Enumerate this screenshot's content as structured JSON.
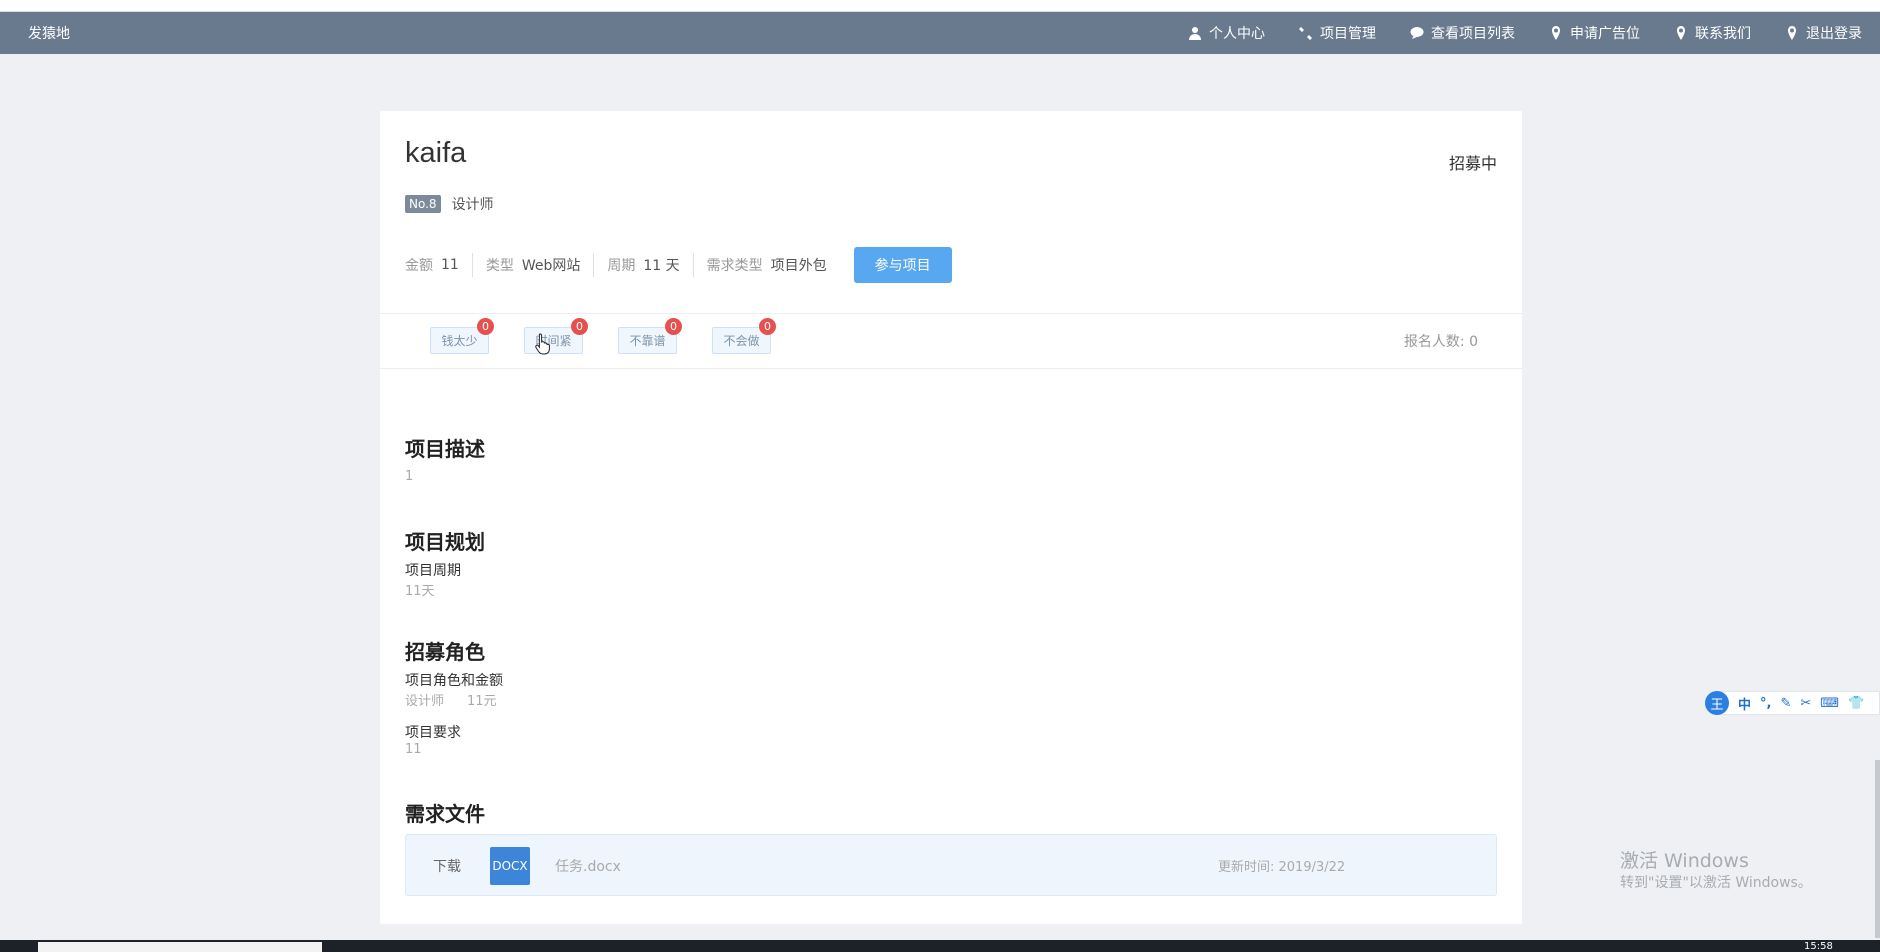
{
  "navbar": {
    "brand": "发猿地",
    "items": [
      {
        "label": "个人中心",
        "icon": "user-icon"
      },
      {
        "label": "项目管理",
        "icon": "wrench-icon"
      },
      {
        "label": "查看项目列表",
        "icon": "comment-icon"
      },
      {
        "label": "申请广告位",
        "icon": "map-marker-icon"
      },
      {
        "label": "联系我们",
        "icon": "map-marker-icon"
      },
      {
        "label": "退出登录",
        "icon": "map-marker-icon"
      }
    ]
  },
  "project": {
    "title": "kaifa",
    "status": "招募中",
    "badge": "No.8",
    "role": "设计师",
    "meta": [
      {
        "key": "金额",
        "value": "11"
      },
      {
        "key": "类型",
        "value": "Web网站"
      },
      {
        "key": "周期",
        "value": "11 天"
      },
      {
        "key": "需求类型",
        "value": "项目外包"
      }
    ],
    "join_label": "参与项目"
  },
  "feedback": {
    "tags": [
      {
        "label": "钱太少",
        "count": "0"
      },
      {
        "label": "时间紧",
        "count": "0"
      },
      {
        "label": "不靠谱",
        "count": "0"
      },
      {
        "label": "不会做",
        "count": "0"
      }
    ],
    "signup": "报名人数: 0"
  },
  "sections": {
    "description": {
      "title": "项目描述",
      "value": "1"
    },
    "plan": {
      "title": "项目规划",
      "label": "项目周期",
      "value": "11天"
    },
    "recruit": {
      "title": "招募角色",
      "role_label": "项目角色和金额",
      "role_value": "设计师",
      "amount_value": "11元",
      "req_label": "项目要求",
      "req_value": "11"
    },
    "files": {
      "title": "需求文件",
      "download": "下载",
      "icon_text": "DOCX",
      "filename": "任务.docx",
      "updated": "更新时间: 2019/3/22"
    }
  },
  "ime": {
    "logo": "王",
    "items": [
      "中",
      "°,",
      "✎",
      "✂",
      "⌨",
      "👕"
    ]
  },
  "watermark": {
    "line1": "激活 Windows",
    "line2": "转到\"设置\"以激活 Windows。"
  },
  "taskbar": {
    "clock": "15:58"
  },
  "colors": {
    "navbar": "#6a7a8e",
    "accent": "#58a7f1",
    "badge_red": "#e5514f"
  }
}
